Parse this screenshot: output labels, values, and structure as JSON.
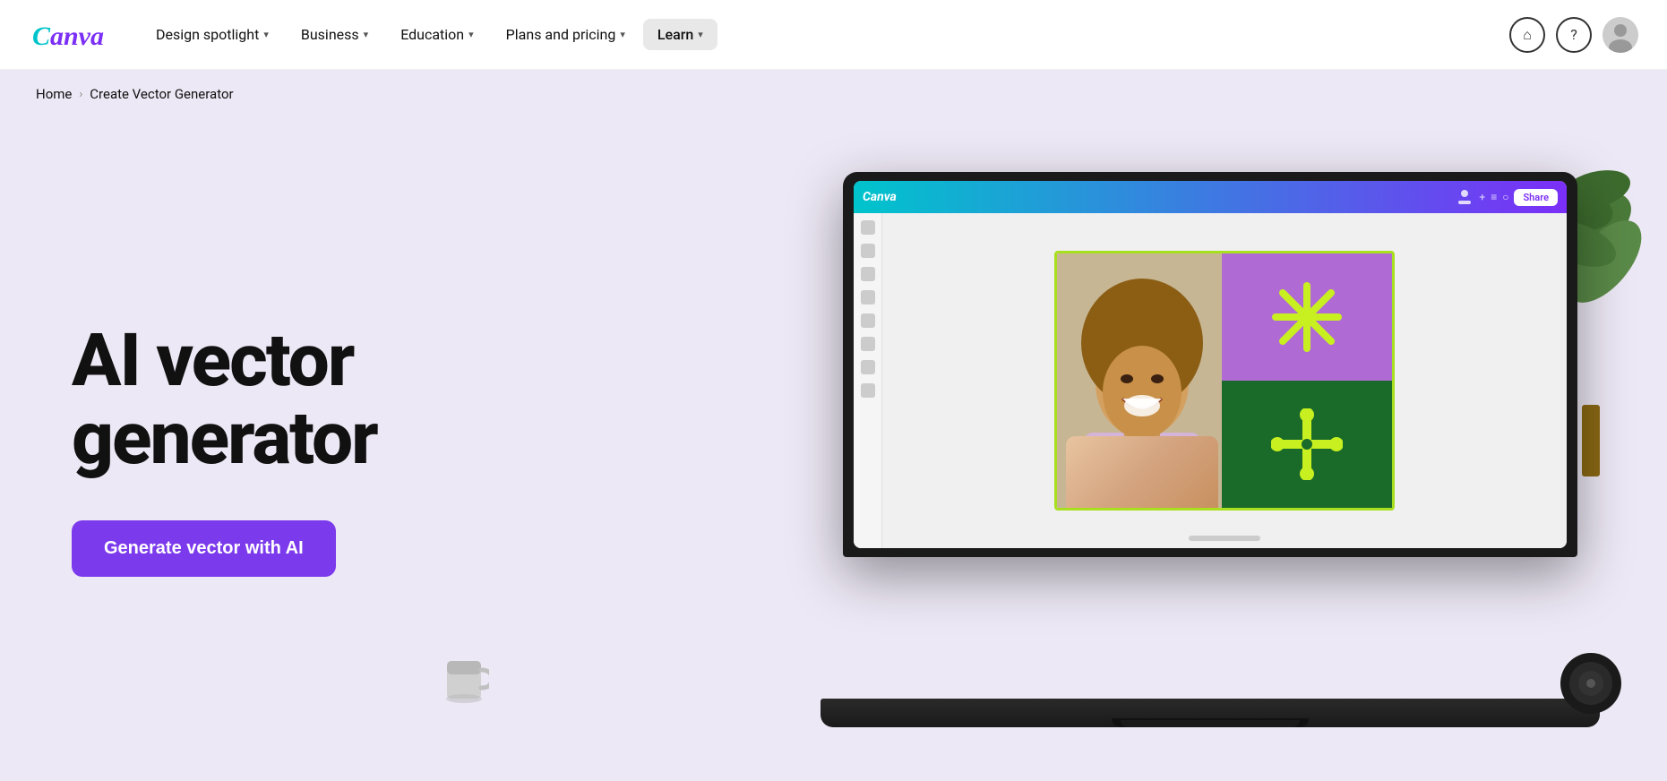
{
  "brand": {
    "name": "Canva",
    "logo_color": "#00c7b7"
  },
  "navbar": {
    "design_spotlight_label": "Design spotlight",
    "business_label": "Business",
    "education_label": "Education",
    "plans_pricing_label": "Plans and pricing",
    "learn_label": "Learn",
    "home_icon": "home-icon",
    "help_icon": "help-icon",
    "avatar_icon": "user-avatar-icon"
  },
  "breadcrumb": {
    "home_label": "Home",
    "separator": "›",
    "current_label": "Create Vector Generator"
  },
  "hero": {
    "title_line1": "AI vector",
    "title_line2": "generator",
    "cta_label": "Generate vector with AI"
  },
  "canva_ui": {
    "logo": "Canva",
    "share_label": "Share",
    "design": {
      "snowflake_char": "✳",
      "crosshair_char": "✛"
    }
  },
  "colors": {
    "nav_bg": "#ffffff",
    "hero_bg": "#ede8f5",
    "cta_bg": "#7c3aed",
    "cta_hover": "#6d28d9",
    "learn_btn_bg": "#e8e8e8",
    "panel_top_bg": "#b06ad4",
    "panel_bottom_bg": "#1a6b2a",
    "border_color": "#a8e020",
    "design_color": "#c8f020"
  }
}
